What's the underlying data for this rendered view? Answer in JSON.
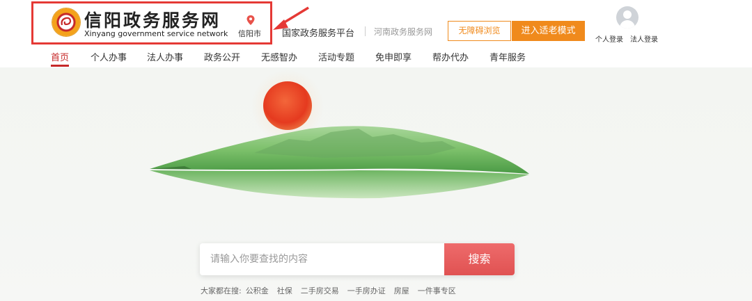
{
  "header": {
    "site_name": "信阳政务服务网",
    "site_name_en": "Xinyang government service network",
    "city": "信阳市",
    "national_platform": "国家政务服务平台",
    "provincial_site": "河南政务服务网",
    "accessible_browse": "无障碍浏览",
    "elder_mode": "进入适老模式",
    "personal_login": "个人登录",
    "corporate_login": "法人登录"
  },
  "nav": {
    "items": [
      {
        "label": "首页"
      },
      {
        "label": "个人办事"
      },
      {
        "label": "法人办事"
      },
      {
        "label": "政务公开"
      },
      {
        "label": "无感智办"
      },
      {
        "label": "活动专题"
      },
      {
        "label": "免申即享"
      },
      {
        "label": "帮办代办"
      },
      {
        "label": "青年服务"
      }
    ],
    "active": "首页"
  },
  "search": {
    "placeholder": "请输入你要查找的内容",
    "button_label": "搜索"
  },
  "hot_searches": {
    "label": "大家都在搜:",
    "items": [
      "公积金",
      "社保",
      "二手房交易",
      "一手房办证",
      "房屋",
      "一件事专区"
    ]
  },
  "colors": {
    "accent_red": "#c62828",
    "orange": "#f08a1c",
    "highlight_border": "#e53935",
    "search_button": "#e05252"
  },
  "icons": [
    "logo-emblem",
    "location-pin-icon",
    "avatar-icon",
    "annotation-arrow"
  ]
}
